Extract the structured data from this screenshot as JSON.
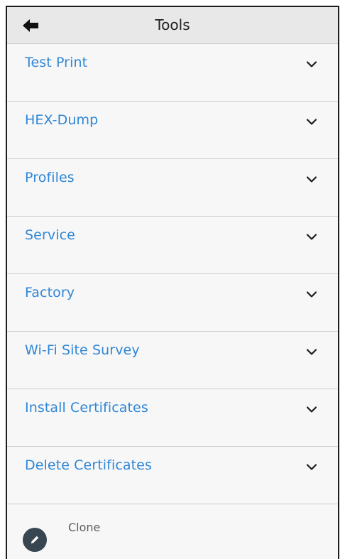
{
  "header": {
    "title": "Tools",
    "back_icon": "arrow-left-icon"
  },
  "menu": {
    "items": [
      {
        "label": "Test Print",
        "icon": "chevron-down-icon"
      },
      {
        "label": "HEX-Dump",
        "icon": "chevron-down-icon"
      },
      {
        "label": "Profiles",
        "icon": "chevron-down-icon"
      },
      {
        "label": "Service",
        "icon": "chevron-down-icon"
      },
      {
        "label": "Factory",
        "icon": "chevron-down-icon"
      },
      {
        "label": "Wi-Fi Site Survey",
        "icon": "chevron-down-icon"
      },
      {
        "label": "Install Certificates",
        "icon": "chevron-down-icon"
      },
      {
        "label": "Delete Certificates",
        "icon": "chevron-down-icon"
      }
    ]
  },
  "footer": {
    "clone_label": "Clone",
    "clone_icon": "pencil-icon"
  },
  "colors": {
    "accent": "#2f86d6",
    "header_background": "#e8e8e8",
    "page_background": "#f7f7f7",
    "divider": "#cfcfcf",
    "clone_button": "#384651"
  }
}
